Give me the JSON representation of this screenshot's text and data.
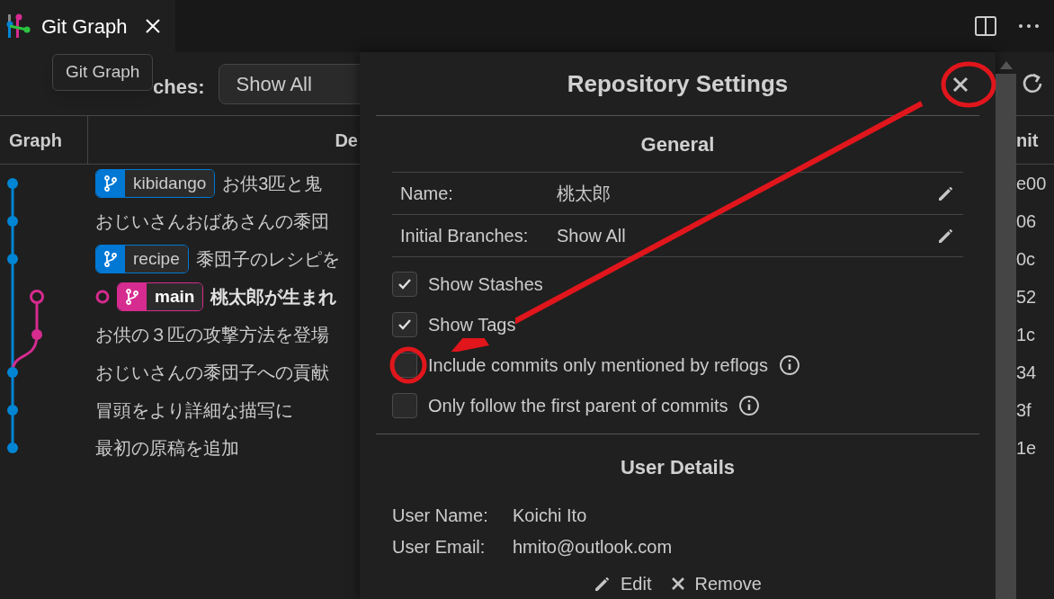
{
  "tab": {
    "title": "Git Graph",
    "tooltip": "Git Graph"
  },
  "toolbar": {
    "branches_label": "ches:",
    "branches_value": "Show All"
  },
  "table": {
    "columns": [
      "Graph",
      "De",
      "nit"
    ],
    "rows": [
      {
        "message": "お供3匹と鬼",
        "hash": "e00",
        "kind": "base",
        "color": "#0085d4",
        "tag": {
          "label": "kibidango",
          "color": "#0078d4"
        },
        "head": false
      },
      {
        "message": "おじいさんおばあさんの黍団",
        "hash": "06",
        "kind": "base",
        "color": "#0085d4",
        "head": false
      },
      {
        "message": "黍団子のレシピを",
        "hash": "0c",
        "kind": "base",
        "color": "#0085d4",
        "tag": {
          "label": "recipe",
          "color": "#0078d4"
        },
        "head": false
      },
      {
        "message": "桃太郎が生まれ",
        "hash": "52",
        "kind": "side",
        "color": "#d62b8f",
        "tag": {
          "label": "main",
          "color": "#d62b8f"
        },
        "head": true
      },
      {
        "message": "お供の３匹の攻撃方法を登場",
        "hash": "1c",
        "kind": "side",
        "color": "#d62b8f",
        "head": false
      },
      {
        "message": "おじいさんの黍団子への貢献",
        "hash": "34",
        "kind": "base",
        "color": "#0085d4",
        "head": false
      },
      {
        "message": "冒頭をより詳細な描写に",
        "hash": "3f",
        "kind": "base",
        "color": "#0085d4",
        "head": false
      },
      {
        "message": "最初の原稿を追加",
        "hash": "1e",
        "kind": "base",
        "color": "#0085d4",
        "head": false
      }
    ]
  },
  "dialog": {
    "title": "Repository Settings",
    "general": {
      "heading": "General",
      "fields": [
        {
          "label": "Name:",
          "value": "桃太郎"
        },
        {
          "label": "Initial Branches:",
          "value": "Show All"
        }
      ],
      "options": [
        {
          "label": "Show Stashes",
          "checked": true,
          "info": false
        },
        {
          "label": "Show Tags",
          "checked": true,
          "info": false
        },
        {
          "label": "Include commits only mentioned by reflogs",
          "checked": false,
          "info": true
        },
        {
          "label": "Only follow the first parent of commits",
          "checked": false,
          "info": true
        }
      ]
    },
    "user": {
      "heading": "User Details",
      "fields": [
        {
          "label": "User Name:",
          "value": "Koichi Ito"
        },
        {
          "label": "User Email:",
          "value": "hmito@outlook.com"
        }
      ],
      "actions": [
        {
          "kind": "edit",
          "label": "Edit"
        },
        {
          "kind": "remove",
          "label": "Remove"
        }
      ]
    }
  }
}
